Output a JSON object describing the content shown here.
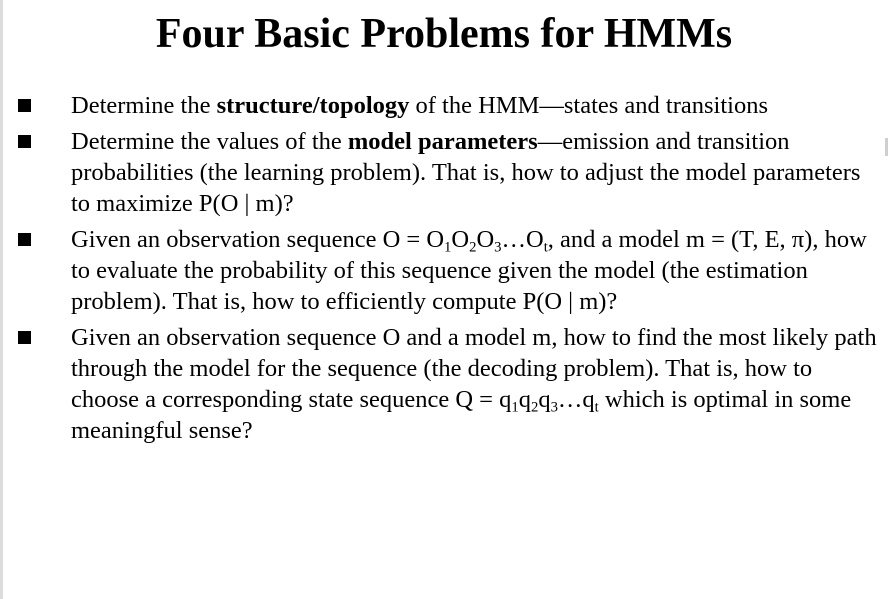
{
  "slide": {
    "title": "Four Basic Problems for HMMs",
    "bullets": [
      {
        "segments": [
          {
            "t": "Determine the "
          },
          {
            "t": "structure/topology",
            "b": true
          },
          {
            "t": " of the HMM—states and transitions"
          }
        ]
      },
      {
        "segments": [
          {
            "t": "Determine the values of the "
          },
          {
            "t": "model parameters",
            "b": true
          },
          {
            "t": "—emission and transition probabilities (the learning problem). That is, how to adjust the model parameters to maximize P(O | m)?"
          }
        ]
      },
      {
        "segments": [
          {
            "t": "Given an observation sequence O = O"
          },
          {
            "t": "1",
            "sub": true
          },
          {
            "t": "O"
          },
          {
            "t": "2",
            "sub": true
          },
          {
            "t": "O"
          },
          {
            "t": "3",
            "sub": true
          },
          {
            "t": "…O"
          },
          {
            "t": "t",
            "sub": true
          },
          {
            "t": ", and a model m = (T, E, π), how to evaluate the probability of this sequence given the model (the estimation problem). That is, how to efficiently compute P(O | m)?"
          }
        ]
      },
      {
        "segments": [
          {
            "t": "Given an observation sequence O and a model m, how to find the most likely path through the model for the sequence (the decoding problem). That is, how to choose a corresponding state sequence Q = q"
          },
          {
            "t": "1",
            "sub": true
          },
          {
            "t": "q"
          },
          {
            "t": "2",
            "sub": true
          },
          {
            "t": "q"
          },
          {
            "t": "3",
            "sub": true
          },
          {
            "t": "…q"
          },
          {
            "t": "t",
            "sub": true
          },
          {
            "t": " which is optimal in some meaningful sense?"
          }
        ]
      }
    ]
  }
}
